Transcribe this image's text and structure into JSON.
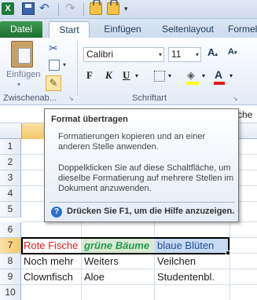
{
  "tabs": [
    "Datei",
    "Start",
    "Einfügen",
    "Seitenlayout",
    "Formel"
  ],
  "qat": {
    "app_icon": "excel-app-icon",
    "undo_icon": "undo-icon",
    "redo_icon": "redo-icon"
  },
  "ribbon": {
    "paste_label": "Einfügen",
    "clipboard_group": "Zwischenab...",
    "font_group": "Schriftart",
    "font_name": "Calibri",
    "font_size": "11",
    "bold": "F",
    "italic": "K",
    "underline": "U",
    "fill_color": "#ffff00",
    "font_color": "#e51b1b"
  },
  "formula_bar": {
    "visible_text": "che"
  },
  "tooltip": {
    "title": "Format übertragen",
    "body1": "Formatierungen kopieren und an einer anderen Stelle anwenden.",
    "body2": "Doppelklicken Sie auf diese Schaltfläche, um dieselbe Formatierung auf mehrere Stellen im Dokument anzuwenden.",
    "help": "Drücken Sie F1, um die Hilfe anzuzeigen."
  },
  "rows": [
    "1",
    "2",
    "3",
    "4",
    "5",
    "6",
    "7",
    "8",
    "9",
    "10"
  ],
  "cells": {
    "r7": {
      "a": "Rote Fische",
      "b": "grüne Bäume",
      "c": "blaue Blüten"
    },
    "r8": {
      "a": "Noch mehr",
      "b": "Weiters",
      "c": "Veilchen"
    },
    "r9": {
      "a": "Clownfisch",
      "b": "Aloe",
      "c": "Studentenbl."
    }
  },
  "colors": {
    "red_text": "#e51b1b",
    "green_text": "#1f9a4e",
    "green_fill": "#d9ead3",
    "blue_text": "#1f4e9c",
    "blue_fill": "#c6daf1"
  }
}
